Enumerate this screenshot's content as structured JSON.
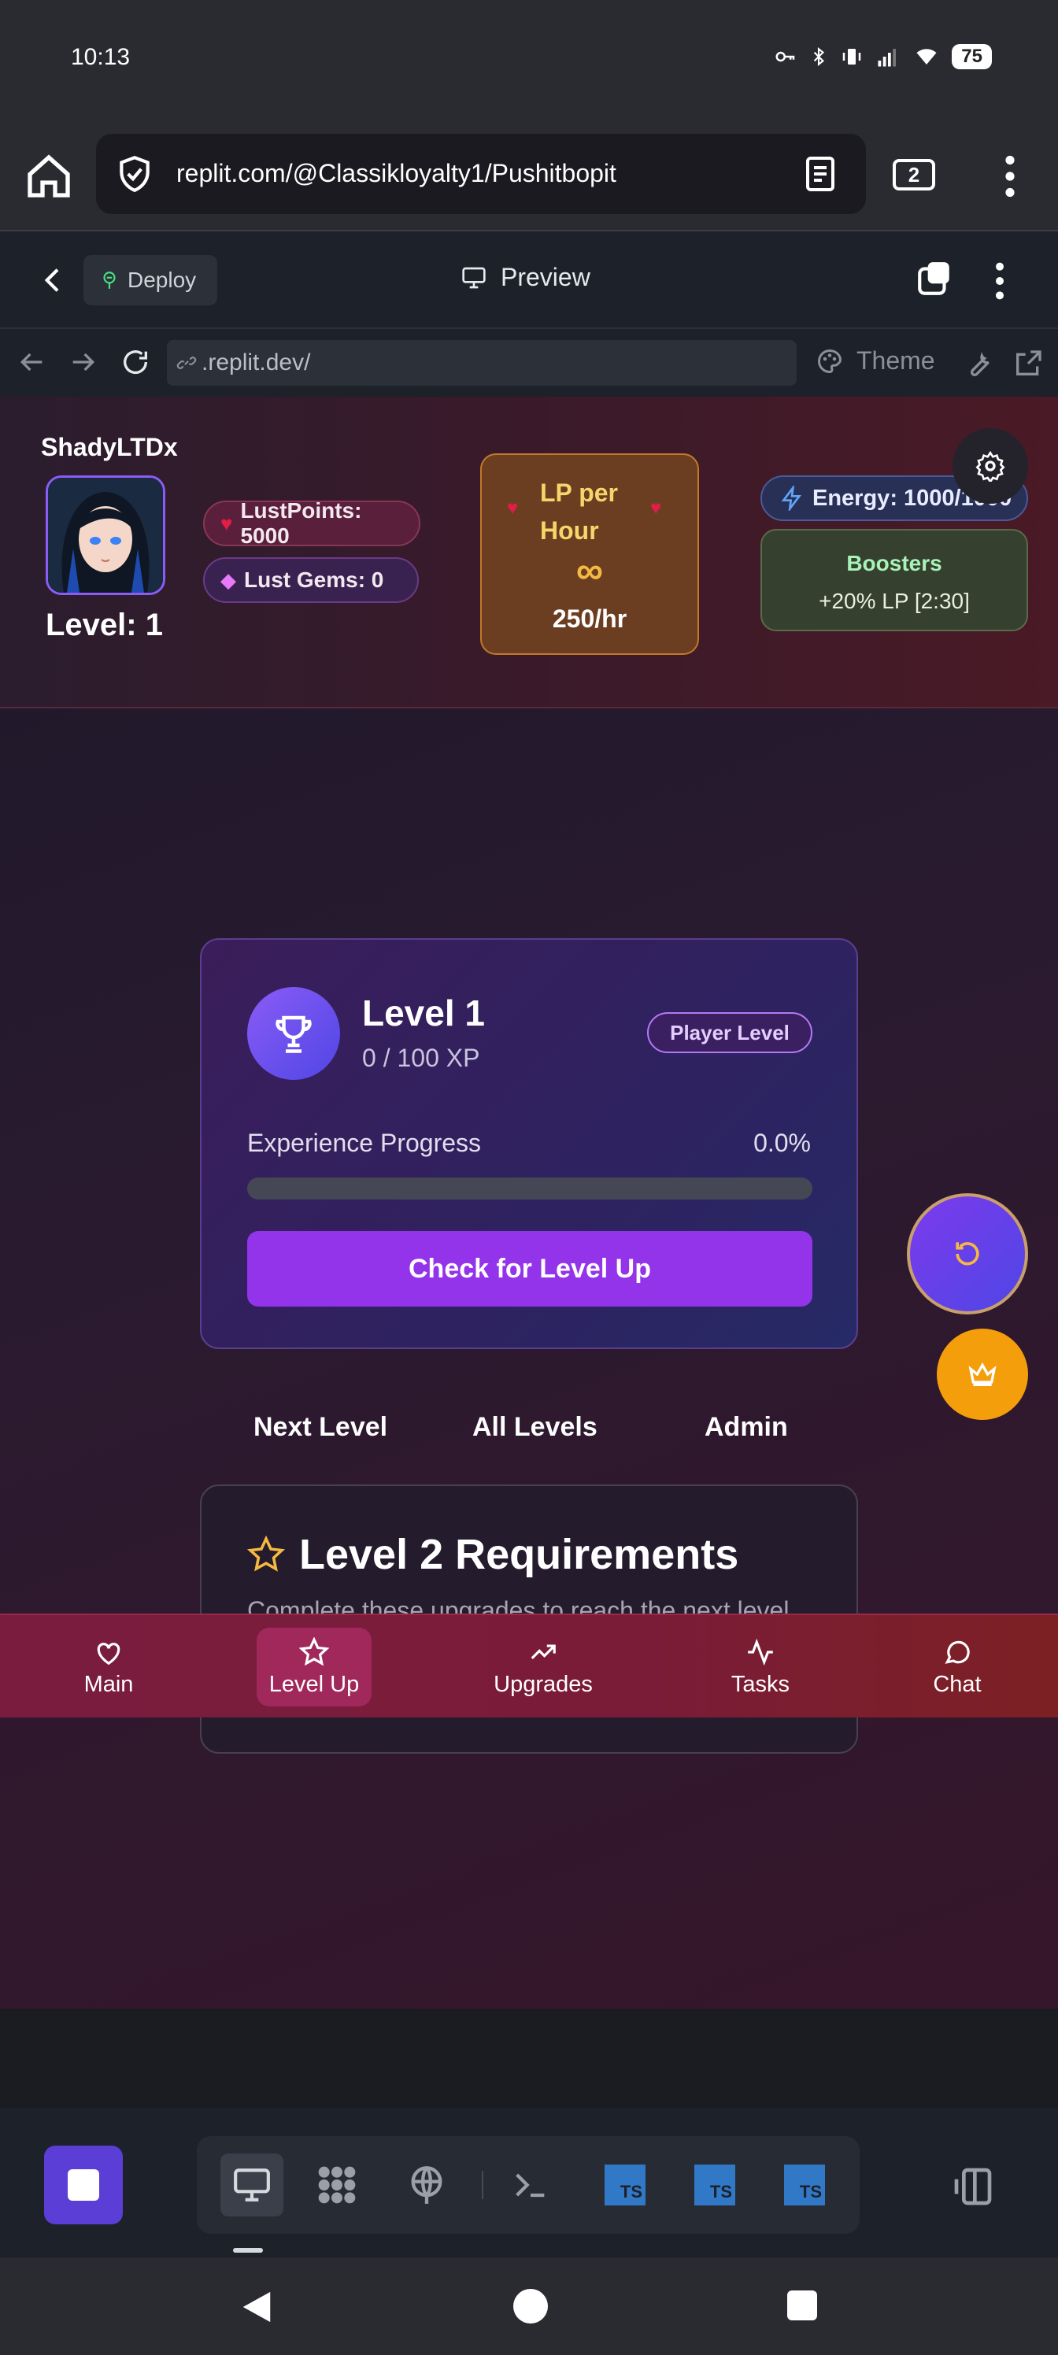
{
  "status_bar": {
    "time": "10:13",
    "battery": "75"
  },
  "browser": {
    "url": "replit.com/@Classikloyalty1/Pushitbopit",
    "tab_count": "2"
  },
  "replit": {
    "deploy_label": "Deploy",
    "preview_label": "Preview",
    "address": ".replit.dev/",
    "theme_label": "Theme"
  },
  "header": {
    "username": "ShadyLTDx",
    "level": "Level: 1",
    "lust_points": "LustPoints: 5000",
    "lust_gems": "Lust Gems: 0",
    "lp_per_hour_title": "LP per Hour",
    "lp_infinity": "∞",
    "lp_rate": "250/hr",
    "energy": "Energy: 1000/1000",
    "boosters_title": "Boosters",
    "boosters_value": "+20% LP [2:30]"
  },
  "level_card": {
    "title": "Level 1",
    "xp": "0 / 100 XP",
    "badge": "Player Level",
    "progress_label": "Experience Progress",
    "progress_pct": "0.0%",
    "progress_fraction": 0.0,
    "button": "Check for Level Up"
  },
  "subtabs": [
    "Next Level",
    "All Levels",
    "Admin"
  ],
  "requirements": {
    "title": "Level 2 Requirements",
    "subtitle": "Complete these upgrades to reach the next level"
  },
  "bottom_nav": [
    {
      "label": "Main",
      "icon": "heart-icon"
    },
    {
      "label": "Level Up",
      "icon": "star-icon",
      "active": true
    },
    {
      "label": "Upgrades",
      "icon": "trending-up-icon"
    },
    {
      "label": "Tasks",
      "icon": "activity-icon"
    },
    {
      "label": "Chat",
      "icon": "chat-icon"
    }
  ],
  "colors": {
    "accent": "#9333ea",
    "bottom_nav_bg": "#7a1c3e",
    "lp_card": "#6b3e22",
    "crown_button": "#f59e0b"
  }
}
